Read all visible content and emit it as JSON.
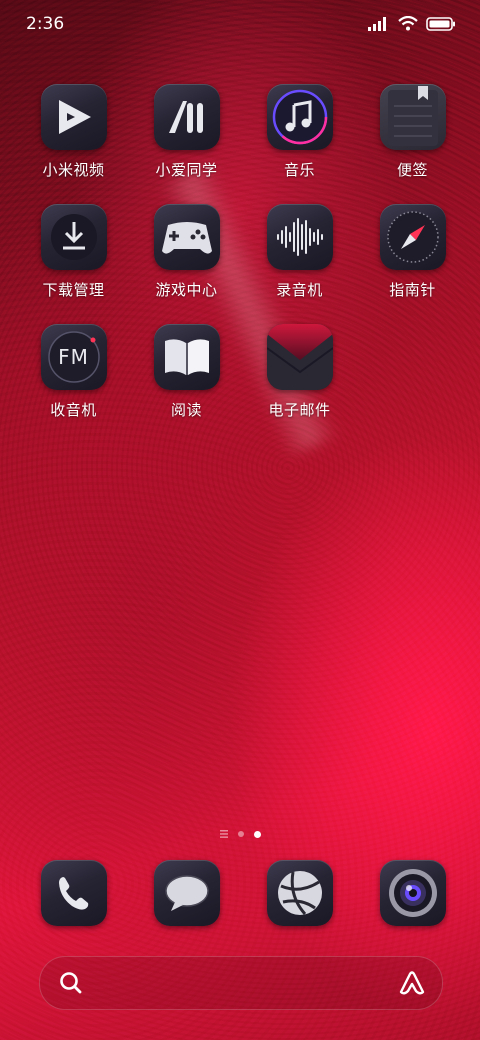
{
  "status_bar": {
    "time": "2:36",
    "icons": [
      "signal-icon",
      "wifi-icon",
      "battery-icon"
    ]
  },
  "apps": [
    {
      "label": "小米视频",
      "icon": "video-play-icon"
    },
    {
      "label": "小爱同学",
      "icon": "xiaoai-icon"
    },
    {
      "label": "音乐",
      "icon": "music-note-icon"
    },
    {
      "label": "便签",
      "icon": "notes-icon"
    },
    {
      "label": "下载管理",
      "icon": "download-icon"
    },
    {
      "label": "游戏中心",
      "icon": "gamepad-icon"
    },
    {
      "label": "录音机",
      "icon": "waveform-icon"
    },
    {
      "label": "指南针",
      "icon": "compass-icon"
    },
    {
      "label": "收音机",
      "icon": "fm-radio-icon",
      "icon_text": "FM"
    },
    {
      "label": "阅读",
      "icon": "book-icon"
    },
    {
      "label": "电子邮件",
      "icon": "email-icon"
    }
  ],
  "page_indicator": {
    "pages": 3,
    "current": 3
  },
  "dock": [
    {
      "icon": "phone-icon"
    },
    {
      "icon": "message-icon"
    },
    {
      "icon": "browser-icon"
    },
    {
      "icon": "camera-icon"
    }
  ],
  "search_bar": {
    "left_icon": "search-icon",
    "right_icon": "assistant-icon"
  },
  "colors": {
    "wallpaper": "#c2142f",
    "icon_bg": "#262433",
    "accent": "#e0163d"
  }
}
